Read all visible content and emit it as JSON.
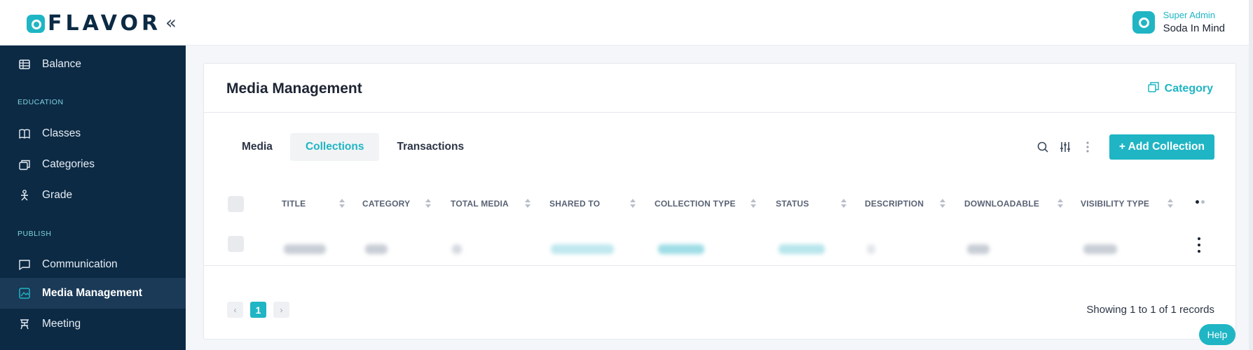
{
  "brand": {
    "name": "FLAVOR",
    "collapse_icon": "double-chevron-left"
  },
  "user": {
    "role": "Super Admin",
    "name": "Soda In Mind"
  },
  "sidebar": {
    "items": [
      {
        "label": "Balance",
        "icon": "balance-icon"
      },
      {
        "section": "EDUCATION"
      },
      {
        "label": "Classes",
        "icon": "book-icon"
      },
      {
        "label": "Categories",
        "icon": "categories-icon"
      },
      {
        "label": "Grade",
        "icon": "grade-icon"
      },
      {
        "section": "PUBLISH"
      },
      {
        "label": "Communication",
        "icon": "chat-icon"
      },
      {
        "label": "Media Management",
        "icon": "media-icon",
        "active": true
      },
      {
        "label": "Meeting",
        "icon": "meeting-icon"
      }
    ]
  },
  "page": {
    "title": "Media Management",
    "category_link": "Category",
    "tabs": [
      {
        "label": "Media",
        "active": false
      },
      {
        "label": "Collections",
        "active": true
      },
      {
        "label": "Transactions",
        "active": false
      }
    ],
    "add_button": "+ Add Collection",
    "columns": [
      "TITLE",
      "CATEGORY",
      "TOTAL MEDIA",
      "SHARED TO",
      "COLLECTION TYPE",
      "STATUS",
      "DESCRIPTION",
      "DOWNLOADABLE",
      "VISIBILITY TYPE"
    ],
    "pagination": {
      "current": "1",
      "prev": "‹",
      "next": "›"
    },
    "records_text": "Showing 1 to 1 of 1 records"
  },
  "help_label": "Help",
  "colors": {
    "accent": "#1fb5c4",
    "sidebar": "#0c2a44",
    "sidebar_active": "#1a3a57"
  }
}
